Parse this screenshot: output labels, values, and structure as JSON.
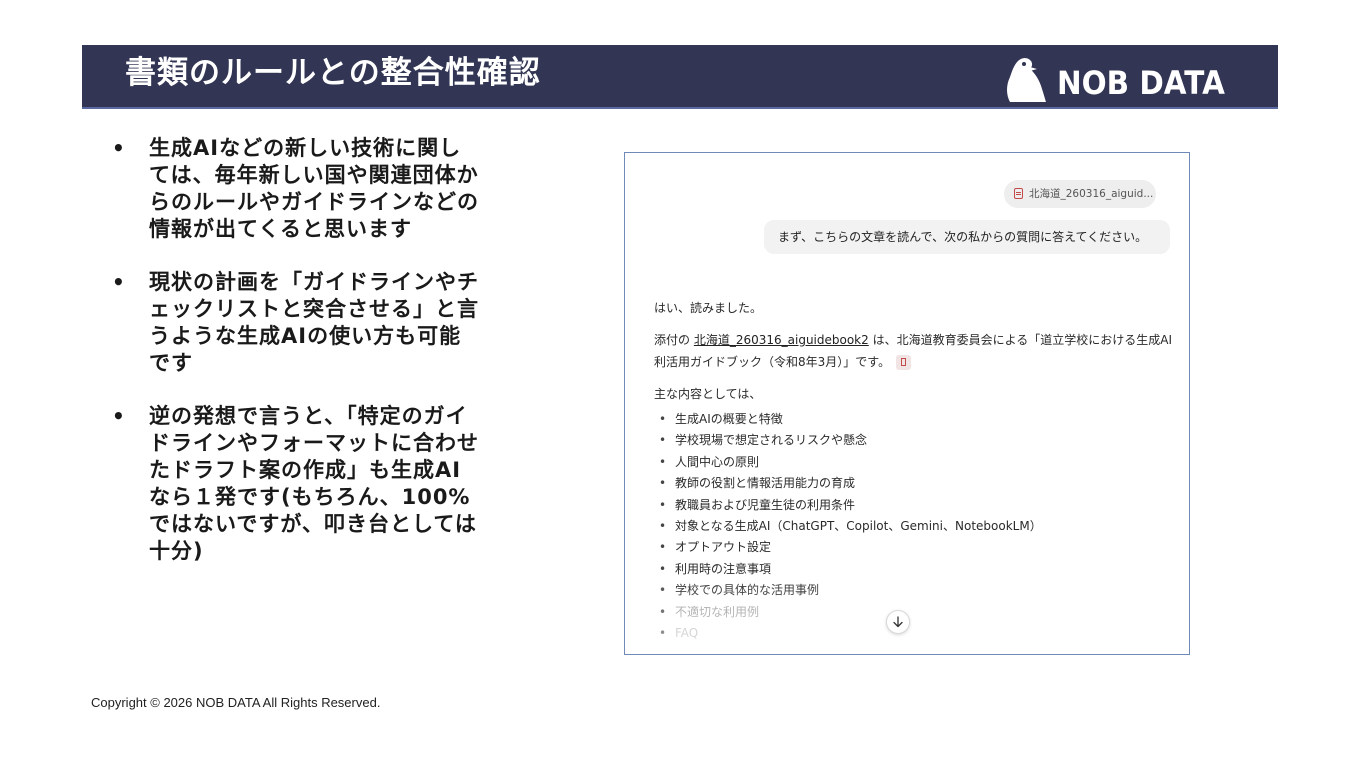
{
  "header": {
    "title": "書類のルールとの整合性確認",
    "logo_text": "NOB DATA",
    "logo_icon": "penguin-icon"
  },
  "bullets": [
    "生成AIなどの新しい技術に関しては、毎年新しい国や関連団体からのルールやガイドラインなどの情報が出てくると思います",
    "現状の計画を「ガイドラインやチェックリストと突合させる」と言うような生成AIの使い方も可能です",
    "逆の発想で言うと、「特定のガイドラインやフォーマットに合わせたドラフト案の作成」も生成AIなら１発です(もちろん、100%ではないですが、叩き台としては十分)"
  ],
  "chat": {
    "file_chip": "北海道_260316_aiguid...",
    "user_message": "まず、こちらの文章を読んで、次の私からの質問に答えてください。",
    "reply_intro": "はい、読みました。",
    "reply_prefix": "添付の ",
    "reply_file": "北海道_260316_aiguidebook2",
    "reply_line1_rest": " は、北海道教育委員会による「道立学校における生成AI",
    "reply_line2": "利活用ガイドブック（令和8年3月）」です。",
    "reply_list_intro": "主な内容としては、",
    "items": [
      "生成AIの概要と特徴",
      "学校現場で想定されるリスクや懸念",
      "人間中心の原則",
      "教師の役割と情報活用能力の育成",
      "教職員および児童生徒の利用条件",
      "対象となる生成AI（ChatGPT、Copilot、Gemini、NotebookLM）",
      "オプトアウト設定",
      "利用時の注意事項",
      "学校での具体的な活用事例",
      "不適切な利用例",
      "FAQ"
    ],
    "scroll_icon": "arrow-down-icon"
  },
  "footer": {
    "copyright": "Copyright © 2026 NOB DATA All Rights Reserved."
  }
}
